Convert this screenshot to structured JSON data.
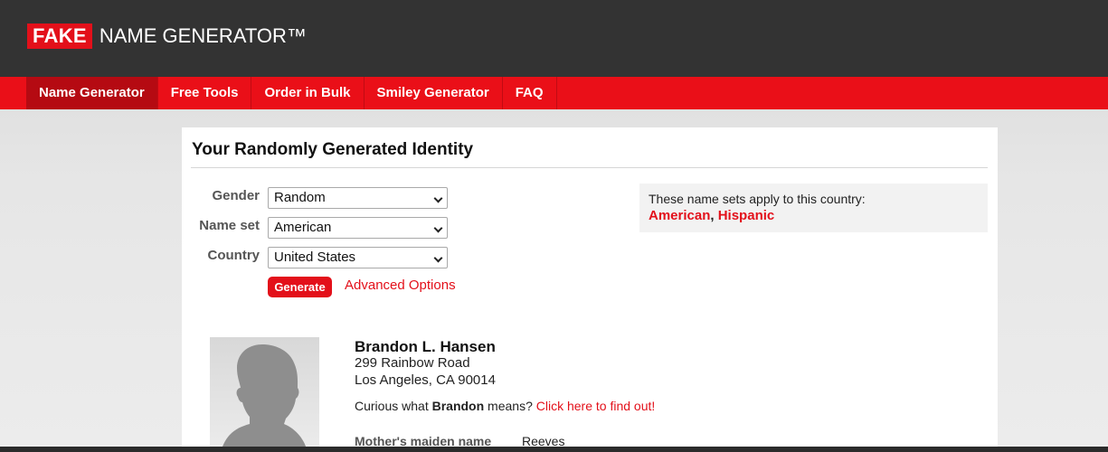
{
  "header": {
    "logo_fake": "FAKE",
    "logo_rest": "NAME GENERATOR™"
  },
  "nav": {
    "items": [
      {
        "label": "Name Generator",
        "active": true
      },
      {
        "label": "Free Tools"
      },
      {
        "label": "Order in Bulk"
      },
      {
        "label": "Smiley Generator"
      },
      {
        "label": "FAQ"
      }
    ]
  },
  "main": {
    "title": "Your Randomly Generated Identity",
    "form": {
      "gender_label": "Gender",
      "gender_value": "Random",
      "nameset_label": "Name set",
      "nameset_value": "American",
      "country_label": "Country",
      "country_value": "United States",
      "generate_label": "Generate",
      "advanced_label": "Advanced Options"
    },
    "info": {
      "text": "These name sets apply to this country:",
      "set1": "American",
      "separator": ", ",
      "set2": "Hispanic"
    },
    "identity": {
      "name": "Brandon L. Hansen",
      "street": "299 Rainbow Road",
      "city": "Los Angeles, CA 90014",
      "curious_prefix": "Curious what ",
      "curious_name": "Brandon",
      "curious_mid": " means? ",
      "curious_link": "Click here to find out!",
      "maiden_label": "Mother's maiden name",
      "maiden_value": "Reeves"
    }
  },
  "colors": {
    "brand_red": "#e3101a",
    "header_dark": "#333333"
  }
}
